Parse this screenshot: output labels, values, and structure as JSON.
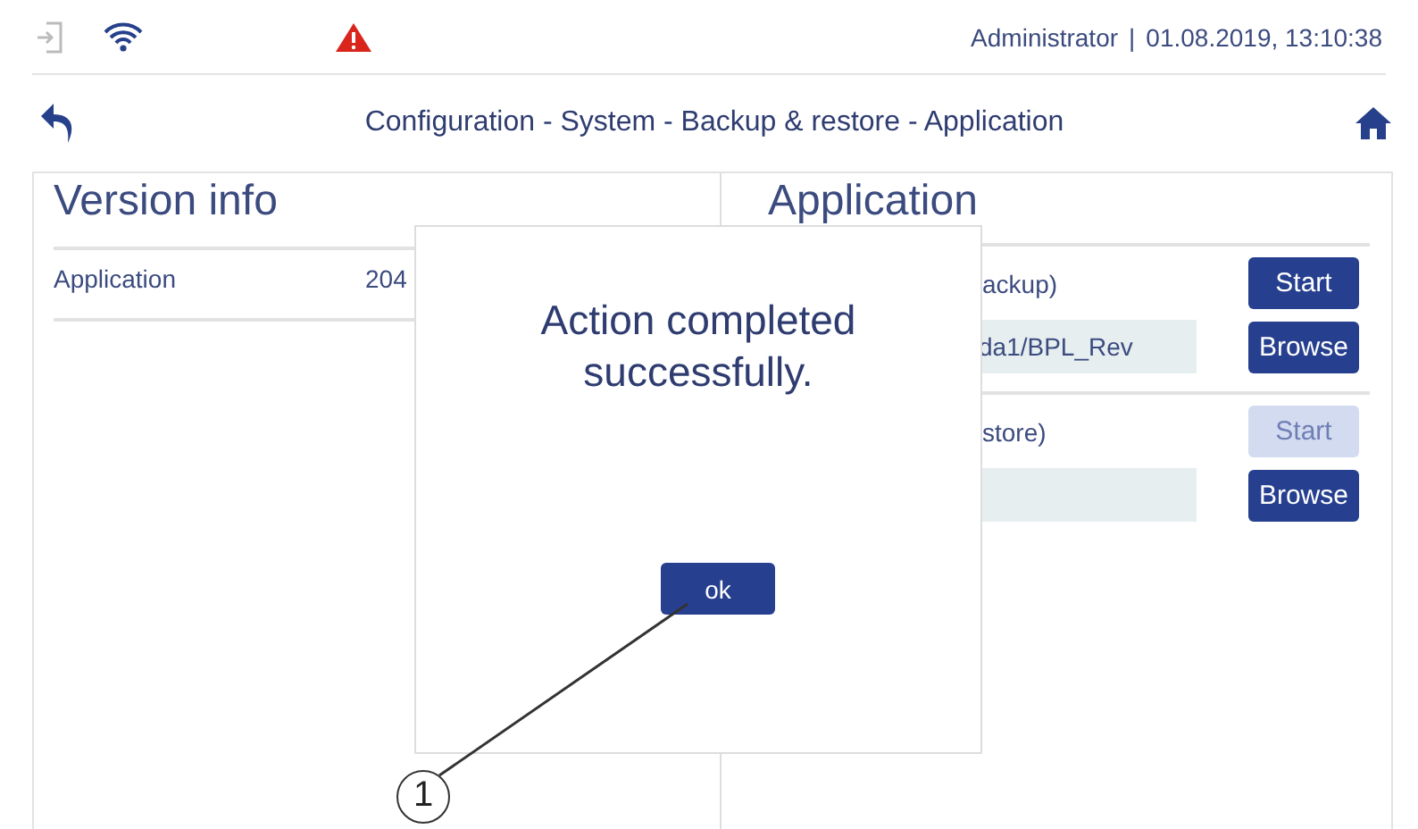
{
  "status_bar": {
    "user": "Administrator",
    "separator": "|",
    "datetime": "01.08.2019, 13:10:38"
  },
  "header": {
    "breadcrumb": "Configuration - System - Backup & restore - Application"
  },
  "version_info": {
    "title": "Version info",
    "rows": [
      {
        "label": "Application",
        "value": "204"
      }
    ]
  },
  "application": {
    "title": "Application",
    "sections": [
      {
        "label": "ackup)",
        "path": "da1/BPL_Rev",
        "start": {
          "label": "Start",
          "disabled": false
        },
        "browse": "Browse"
      },
      {
        "label": "store)",
        "start": {
          "label": "Start",
          "disabled": true
        },
        "browse": "Browse"
      }
    ]
  },
  "dialog": {
    "message": "Action completed successfully.",
    "button": "ok"
  },
  "callout": {
    "number": "1"
  }
}
